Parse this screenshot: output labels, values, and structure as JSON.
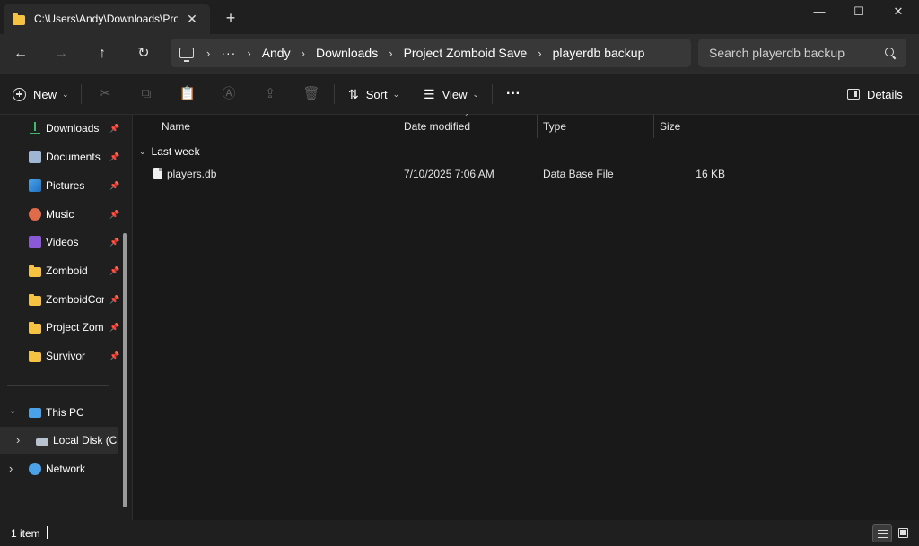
{
  "tab": {
    "title": "C:\\Users\\Andy\\Downloads\\Project Zomboid Save\\playerdb backup",
    "close": "✕",
    "new_tab": "+"
  },
  "window": {
    "minimize": "—",
    "maximize": "☐",
    "close": "✕"
  },
  "nav": {
    "back": "←",
    "forward": "→",
    "up": "↑",
    "refresh": "↻"
  },
  "breadcrumb": {
    "overflow": "···",
    "items": [
      "Andy",
      "Downloads",
      "Project Zomboid Save",
      "playerdb backup"
    ],
    "separator": "›"
  },
  "search": {
    "placeholder": "Search playerdb backup"
  },
  "commandbar": {
    "new_label": "New",
    "sort_label": "Sort",
    "view_label": "View",
    "more_label": "···",
    "details_label": "Details",
    "chevron": "⌄",
    "icons": {
      "cut": "✂",
      "copy": "⧉",
      "paste": "📋",
      "rename": "Ⓐ",
      "share": "⇪",
      "delete": "🗑"
    }
  },
  "sidebar": {
    "pin": "📌",
    "quick_access": [
      {
        "label": "Downloads",
        "icon": "download-icon"
      },
      {
        "label": "Documents",
        "icon": "documents-icon"
      },
      {
        "label": "Pictures",
        "icon": "pictures-icon"
      },
      {
        "label": "Music",
        "icon": "music-icon"
      },
      {
        "label": "Videos",
        "icon": "videos-icon"
      },
      {
        "label": "Zomboid",
        "icon": "folder-icon"
      },
      {
        "label": "ZomboidConfig",
        "icon": "folder-icon"
      },
      {
        "label": "Project Zomboid Save",
        "icon": "folder-icon"
      },
      {
        "label": "Survivor",
        "icon": "folder-icon"
      }
    ],
    "this_pc": "This PC",
    "local_disk": "Local Disk (C:)",
    "network": "Network",
    "expanded_chevron": "⌄",
    "collapsed_chevron": "›"
  },
  "columns": {
    "name": "Name",
    "date": "Date modified",
    "type": "Type",
    "size": "Size",
    "sort_caret": "⌃"
  },
  "group": {
    "label": "Last week",
    "chevron": "⌄"
  },
  "files": [
    {
      "name": "players.db",
      "date": "7/10/2025 7:06 AM",
      "type": "Data Base File",
      "size": "16 KB"
    }
  ],
  "status": {
    "count": "1 item"
  },
  "colors": {
    "accent": "#4aa3e8",
    "folder": "#f5c242",
    "background": "#191919"
  }
}
